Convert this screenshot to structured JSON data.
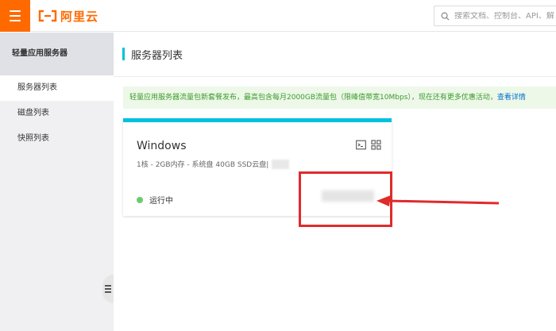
{
  "header": {
    "logo_text": "阿里云",
    "search_placeholder": "搜索文档、控制台、API、解",
    "brand_color": "#ff6a00"
  },
  "sidebar": {
    "title": "轻量应用服务器",
    "items": [
      {
        "label": "服务器列表",
        "active": true
      },
      {
        "label": "磁盘列表",
        "active": false
      },
      {
        "label": "快照列表",
        "active": false
      }
    ]
  },
  "main": {
    "page_title": "服务器列表",
    "notice": {
      "text": "轻量应用服务器流量包新套餐发布，最高包含每月2000GB流量包（限峰值带宽10Mbps），现在还有更多优惠活动，",
      "link": "查看详情"
    },
    "server_card": {
      "name": "Windows",
      "spec": "1核 - 2GB内存 - 系统盘 40GB SSD云盘|",
      "status": "运行中",
      "status_color": "#6ccb6e",
      "accent_color": "#00c1de"
    }
  },
  "icons": [
    "menu-icon",
    "aliyun-logo-icon",
    "search-icon",
    "terminal-icon",
    "apps-grid-icon",
    "collapse-icon"
  ],
  "annotation": {
    "color": "#e02b2b"
  }
}
